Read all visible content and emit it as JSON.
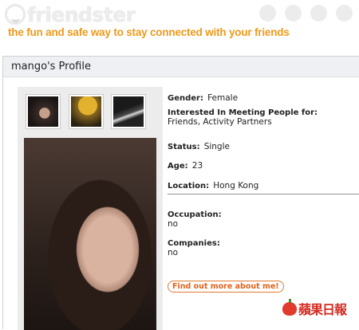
{
  "header": {
    "logo_text": "friendster",
    "tagline": "the fun and safe way to stay connected with your friends"
  },
  "profile": {
    "title": "mango's Profile",
    "fields": {
      "gender_label": "Gender:",
      "gender_value": "Female",
      "interested_label": "Interested In Meeting People for:",
      "interested_value": "Friends, Activity Partners",
      "status_label": "Status:",
      "status_value": "Single",
      "age_label": "Age:",
      "age_value": "23",
      "location_label": "Location:",
      "location_value": "Hong Kong",
      "occupation_label": "Occupation:",
      "occupation_value": "no",
      "companies_label": "Companies:",
      "companies_value": "no"
    },
    "more_button": "Find out more about me!"
  },
  "watermark": {
    "text": "蘋果日報"
  },
  "colors": {
    "tagline": "#ef9a1c",
    "button_border": "#e07a2e",
    "panel_header": "#eef0f3"
  }
}
